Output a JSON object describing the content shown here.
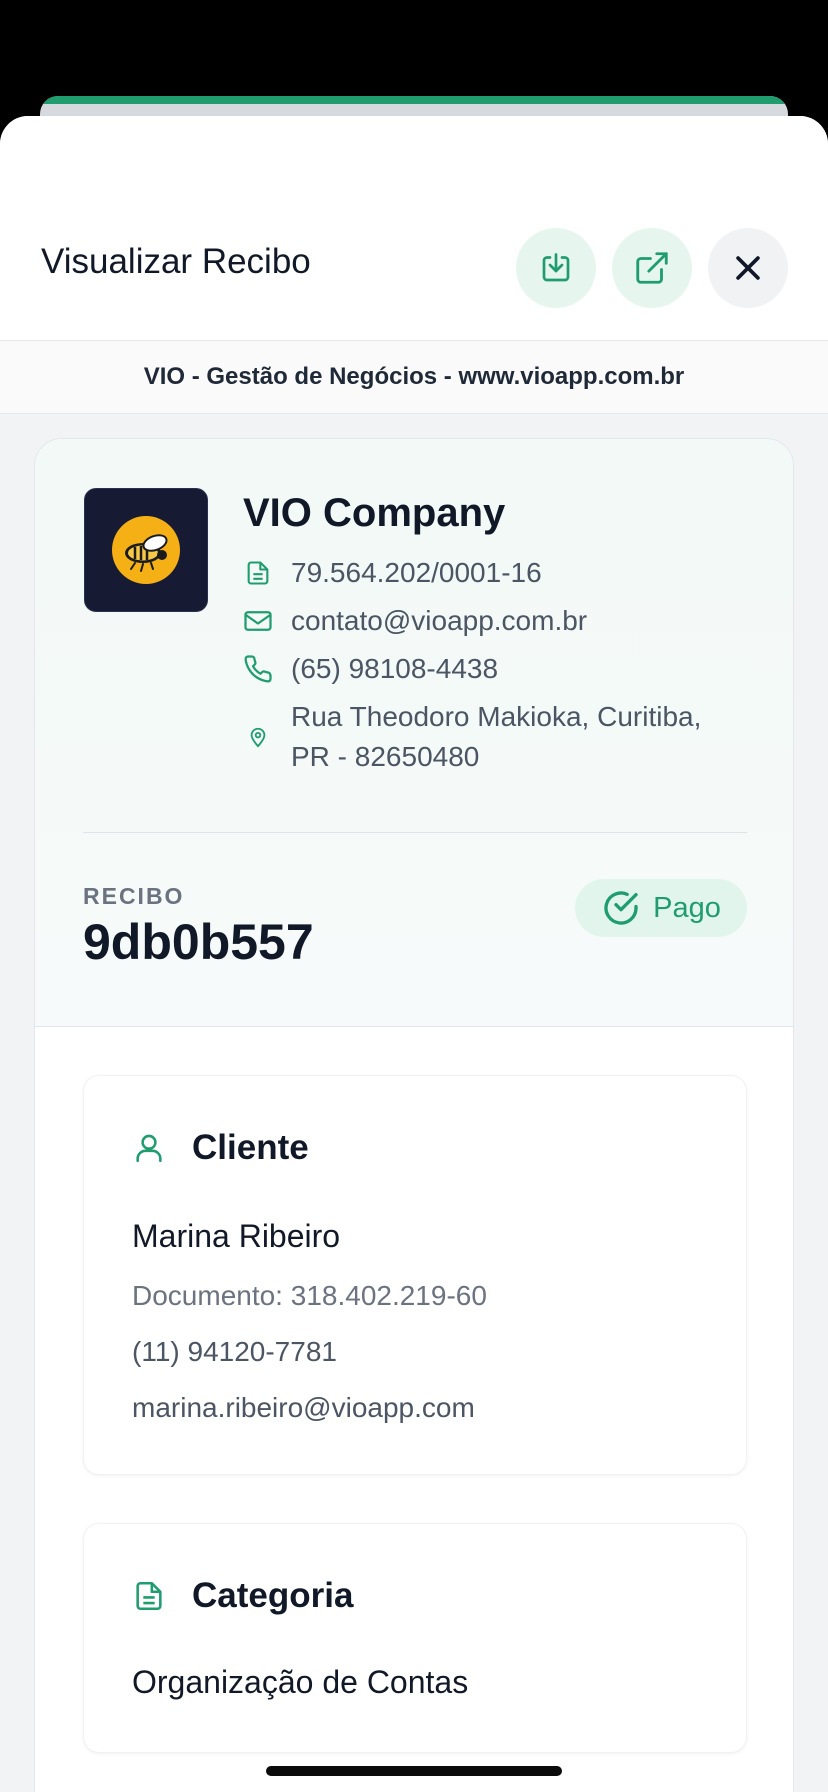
{
  "header": {
    "title": "Visualizar Recibo",
    "download_icon": "download-icon",
    "open_icon": "external-link-icon",
    "close_icon": "close-icon"
  },
  "brand_bar": {
    "text": "VIO - Gestão de Negócios - www.vioapp.com.br"
  },
  "company": {
    "name": "VIO Company",
    "cnpj": "79.564.202/0001-16",
    "email": "contato@vioapp.com.br",
    "phone": "(65) 98108-4438",
    "address": "Rua Theodoro Makioka, Curitiba, PR - 82650480"
  },
  "receipt": {
    "label": "RECIBO",
    "number": "9db0b557",
    "status": "Pago"
  },
  "client": {
    "heading": "Cliente",
    "name": "Marina Ribeiro",
    "document": "Documento: 318.402.219-60",
    "phone": "(11) 94120-7781",
    "email": "marina.ribeiro@vioapp.com"
  },
  "category": {
    "heading": "Categoria",
    "value": "Organização de Contas"
  },
  "colors": {
    "accent": "#1f9d6f",
    "accent_soft": "#e2f5ed",
    "text": "#111827",
    "muted": "#4b5563"
  }
}
